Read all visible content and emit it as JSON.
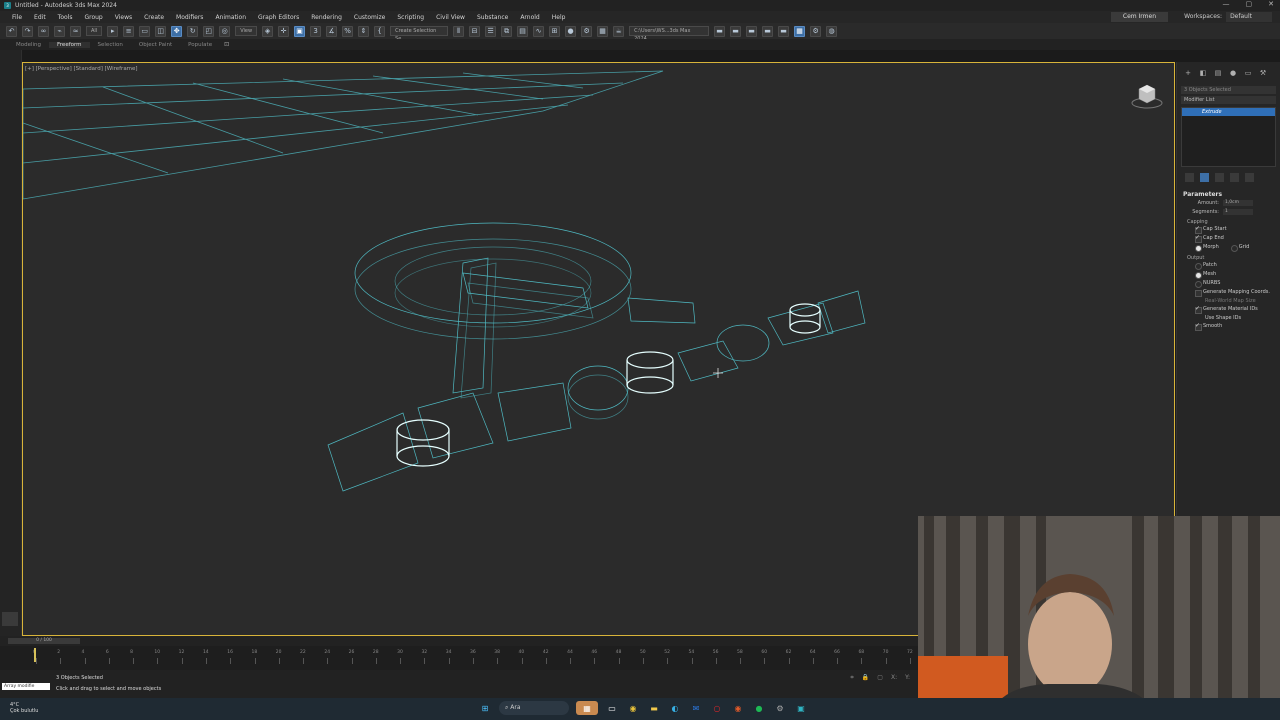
{
  "window": {
    "title": "Untitled - Autodesk 3ds Max 2024",
    "controls": [
      "—",
      "▢",
      "✕"
    ]
  },
  "menu": [
    "File",
    "Edit",
    "Tools",
    "Group",
    "Views",
    "Create",
    "Modifiers",
    "Animation",
    "Graph Editors",
    "Rendering",
    "Customize",
    "Scripting",
    "Civil View",
    "Substance",
    "Arnold",
    "Help"
  ],
  "user": {
    "name": "Cem Irmen",
    "workspaces_label": "Workspaces:",
    "workspace": "Default"
  },
  "toolbar": {
    "filter": "All",
    "view_dropdown": "View",
    "selection_set": "Create Selection Se",
    "project_path": "C:\\Users\\WS...3ds Max 2024"
  },
  "ribbon_tabs": [
    "Modeling",
    "Freeform",
    "Selection",
    "Object Paint",
    "Populate"
  ],
  "ribbon_active": "Freeform",
  "viewport": {
    "label": "[+] [Perspective] [Standard] [Wireframe]"
  },
  "command_panel": {
    "object_name": "3 Objects Selected",
    "modifier_list": "Modifier List",
    "stack_item": "Extrude",
    "parameters": {
      "title": "Parameters",
      "amount_label": "Amount:",
      "amount": "1,0cm",
      "segments_label": "Segments:",
      "segments": "1",
      "capping_label": "Capping",
      "cap_start": "Cap Start",
      "cap_end": "Cap End",
      "morph": "Morph",
      "grid": "Grid",
      "output_label": "Output",
      "patch": "Patch",
      "mesh": "Mesh",
      "nurbs": "NURBS",
      "gen_mapping": "Generate Mapping Coords.",
      "real_world": "Real-World Map Size",
      "gen_material": "Generate Material IDs",
      "use_shape_ids": "Use Shape IDs",
      "smooth": "Smooth"
    }
  },
  "timeline": {
    "frame": "0 / 100",
    "ticks": [
      "0",
      "2",
      "4",
      "6",
      "8",
      "10",
      "12",
      "14",
      "16",
      "18",
      "20",
      "22",
      "24",
      "26",
      "28",
      "30",
      "32",
      "34",
      "36",
      "38",
      "40",
      "42",
      "44",
      "46",
      "48",
      "50",
      "52",
      "54",
      "56",
      "58",
      "60",
      "62",
      "64",
      "66",
      "68",
      "70",
      "72"
    ]
  },
  "status": {
    "maxscript": "Array modifie",
    "selected": "3 Objects Selected",
    "prompt": "Click and drag to select and move objects"
  },
  "taskbar": {
    "weather_temp": "4°C",
    "weather_desc": "Çok bulutlu",
    "search": "Ara"
  },
  "colors": {
    "wire": "#5ad0d8",
    "selected_wire": "#dffcff",
    "viewport_border": "#d8b43a",
    "modifier_highlight": "#2f6fb8"
  }
}
